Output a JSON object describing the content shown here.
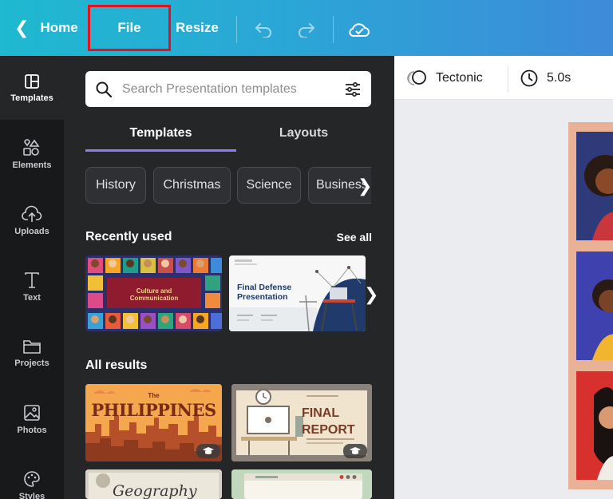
{
  "topbar": {
    "home_label": "Home",
    "file_label": "File",
    "resize_label": "Resize",
    "undo_icon": "undo-icon",
    "redo_icon": "redo-icon",
    "cloud_icon": "cloud-saved-icon",
    "highlight_color": "#e8101a"
  },
  "rail": {
    "items": [
      {
        "label": "Templates",
        "icon": "templates-icon"
      },
      {
        "label": "Elements",
        "icon": "elements-icon"
      },
      {
        "label": "Uploads",
        "icon": "uploads-icon"
      },
      {
        "label": "Text",
        "icon": "text-icon"
      },
      {
        "label": "Projects",
        "icon": "projects-icon"
      },
      {
        "label": "Photos",
        "icon": "photos-icon"
      },
      {
        "label": "Styles",
        "icon": "styles-icon"
      }
    ]
  },
  "panel": {
    "search_placeholder": "Search Presentation templates",
    "tabs": [
      "Templates",
      "Layouts"
    ],
    "chips": [
      "History",
      "Christmas",
      "Science",
      "Business"
    ],
    "recently_used": "Recently used",
    "see_all": "See all",
    "recent": [
      {
        "line1": "Culture and",
        "line2": "Communication"
      },
      {
        "line1": "Final Defense",
        "line2": "Presentation"
      }
    ],
    "all_results": "All results",
    "results": [
      {
        "title": "PHILIPPINES",
        "kicker": "The"
      },
      {
        "line1": "FINAL",
        "line2": "REPORT"
      },
      {
        "title": "Geography"
      }
    ]
  },
  "editor": {
    "font_name": "Tectonic",
    "duration": "5.0s"
  }
}
